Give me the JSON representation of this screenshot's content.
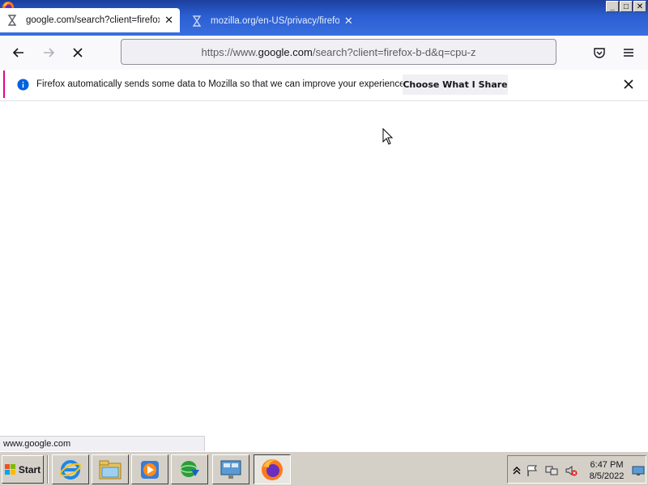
{
  "browser": {
    "tabs": [
      {
        "title": "google.com/search?client=firefox-b-d&q=cpu-z",
        "active": true,
        "icon": "loading-hourglass-icon"
      },
      {
        "title": "mozilla.org/en-US/privacy/firefox/",
        "active": false,
        "icon": "loading-hourglass-icon"
      }
    ],
    "window_controls": {
      "minimize": "_",
      "maximize": "□",
      "close": "✕"
    },
    "url": {
      "prefix": "https://www.",
      "host": "google.com",
      "path": "/search?client=firefox-b-d&q=cpu-z"
    },
    "nav_icons": [
      "back-arrow-icon",
      "forward-arrow-icon",
      "stop-loading-icon",
      "pocket-icon",
      "menu-icon"
    ]
  },
  "notification": {
    "text": "Firefox automatically sends some data to Mozilla so that we can improve your experience.",
    "button_label": "Choose What I Share",
    "accent": "#e8008a"
  },
  "status_link": "www.google.com",
  "taskbar": {
    "start_label": "Start",
    "apps": [
      "internet-explorer-icon",
      "file-explorer-icon",
      "media-player-icon",
      "download-manager-icon",
      "remote-desktop-icon",
      "firefox-icon"
    ],
    "clock": {
      "time": "6:47 PM",
      "date": "8/5/2022"
    }
  }
}
